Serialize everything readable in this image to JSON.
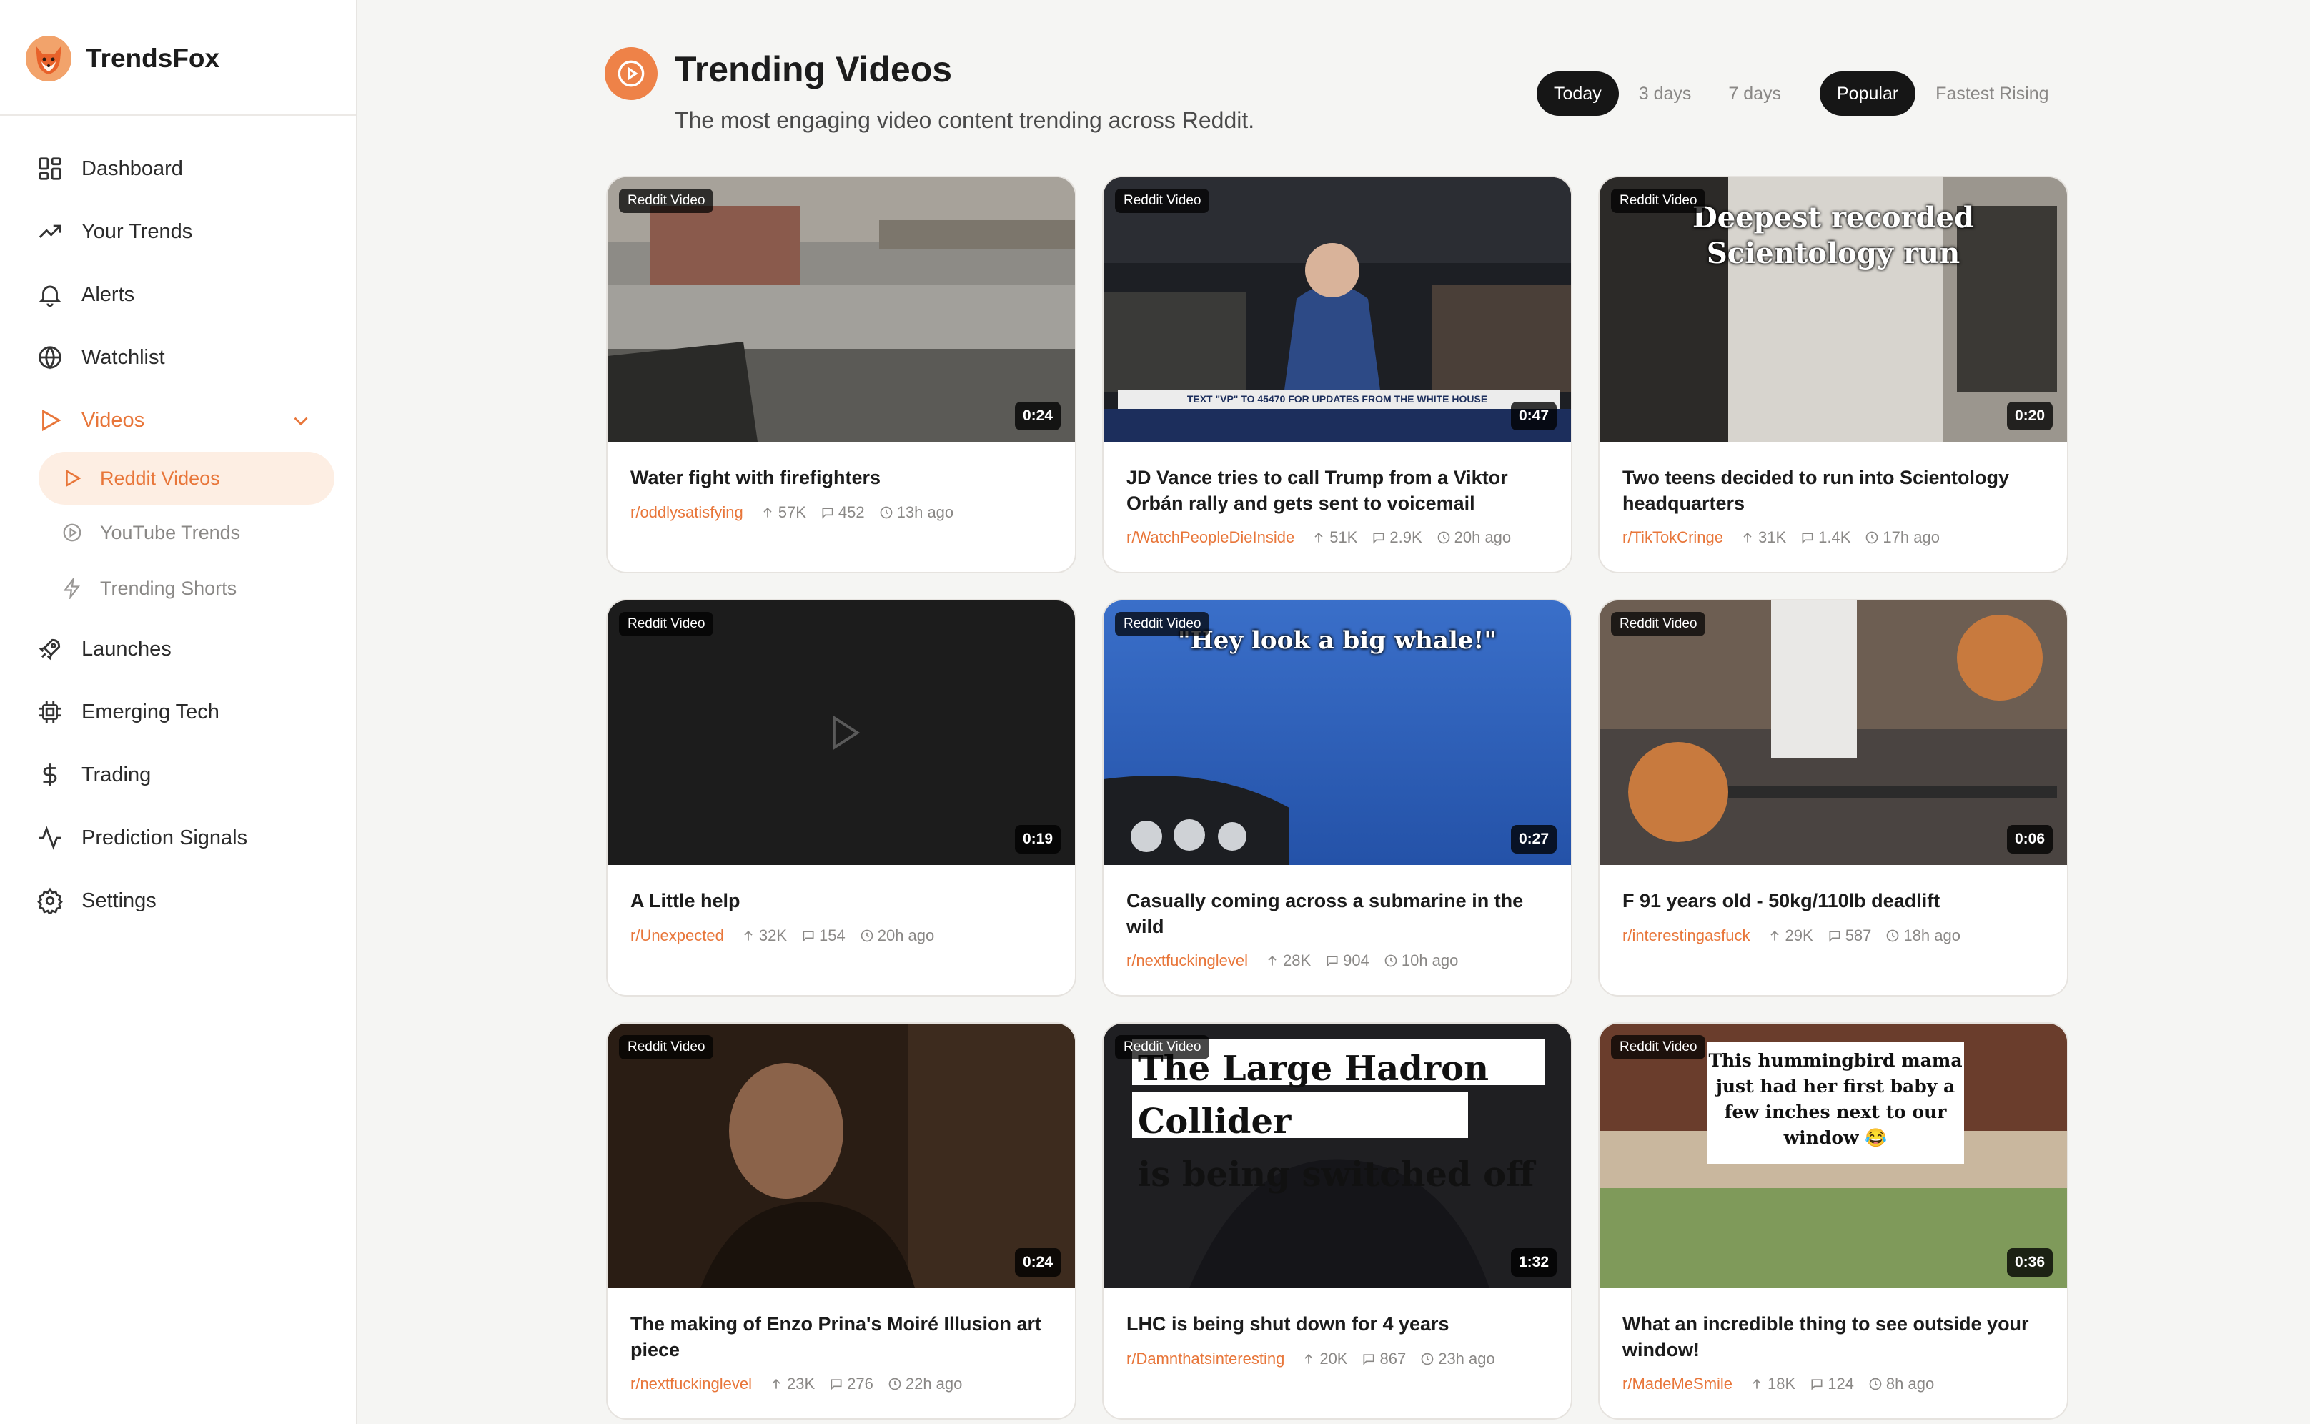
{
  "brand": {
    "name": "TrendsFox"
  },
  "nav": {
    "dashboard": "Dashboard",
    "your_trends": "Your Trends",
    "alerts": "Alerts",
    "watchlist": "Watchlist",
    "videos": "Videos",
    "sub": {
      "reddit_videos": "Reddit Videos",
      "youtube_trends": "YouTube Trends",
      "trending_shorts": "Trending Shorts"
    },
    "launches": "Launches",
    "emerging_tech": "Emerging Tech",
    "trading": "Trading",
    "prediction_signals": "Prediction Signals",
    "settings": "Settings"
  },
  "header": {
    "title": "Trending Videos",
    "subtitle": "The most engaging video content trending across Reddit."
  },
  "filters": {
    "range": [
      "Today",
      "3 days",
      "7 days"
    ],
    "range_selected": "Today",
    "sort": [
      "Popular",
      "Fastest Rising"
    ],
    "sort_selected": "Popular"
  },
  "colors": {
    "accent": "#e8763a",
    "active_pill": "#161616",
    "active_nav_bg": "#fdeee3"
  },
  "videos": [
    {
      "badge": "Reddit Video",
      "duration": "0:24",
      "title": "Water fight with firefighters",
      "subreddit": "r/oddlysatisfying",
      "upvotes": "57K",
      "comments": "452",
      "age": "13h ago"
    },
    {
      "badge": "Reddit Video",
      "duration": "0:47",
      "title": "JD Vance tries to call Trump from a Viktor Orbán rally and gets sent to voicemail",
      "subreddit": "r/WatchPeopleDieInside",
      "upvotes": "51K",
      "comments": "2.9K",
      "age": "20h ago",
      "overlay": "TEXT \"VP\" TO 45470 FOR UPDATES FROM THE WHITE HOUSE"
    },
    {
      "badge": "Reddit Video",
      "duration": "0:20",
      "title": "Two teens decided to run into Scientology headquarters",
      "subreddit": "r/TikTokCringe",
      "upvotes": "31K",
      "comments": "1.4K",
      "age": "17h ago",
      "overlay": [
        "Deepest recorded",
        "Scientology run"
      ]
    },
    {
      "badge": "Reddit Video",
      "duration": "0:19",
      "title": "A Little help",
      "subreddit": "r/Unexpected",
      "upvotes": "32K",
      "comments": "154",
      "age": "20h ago"
    },
    {
      "badge": "Reddit Video",
      "duration": "0:27",
      "title": "Casually coming across a submarine in the wild",
      "subreddit": "r/nextfuckinglevel",
      "upvotes": "28K",
      "comments": "904",
      "age": "10h ago",
      "overlay": "\"Hey look a big whale!\""
    },
    {
      "badge": "Reddit Video",
      "duration": "0:06",
      "title": "F 91 years old - 50kg/110lb deadlift",
      "subreddit": "r/interestingasfuck",
      "upvotes": "29K",
      "comments": "587",
      "age": "18h ago"
    },
    {
      "badge": "Reddit Video",
      "duration": "0:24",
      "title": "The making of Enzo Prina's Moiré Illusion art piece",
      "subreddit": "r/nextfuckinglevel",
      "upvotes": "23K",
      "comments": "276",
      "age": "22h ago"
    },
    {
      "badge": "Reddit Video",
      "duration": "1:32",
      "title": "LHC is being shut down for 4 years",
      "subreddit": "r/Damnthatsinteresting",
      "upvotes": "20K",
      "comments": "867",
      "age": "23h ago",
      "overlay": [
        "The Large Hadron Collider",
        "is being switched off"
      ]
    },
    {
      "badge": "Reddit Video",
      "duration": "0:36",
      "title": "What an incredible thing to see outside your window!",
      "subreddit": "r/MadeMeSmile",
      "upvotes": "18K",
      "comments": "124",
      "age": "8h ago",
      "overlay": [
        "This hummingbird mama",
        "just had her first baby a",
        "few inches next to our",
        "window 😂"
      ]
    }
  ]
}
